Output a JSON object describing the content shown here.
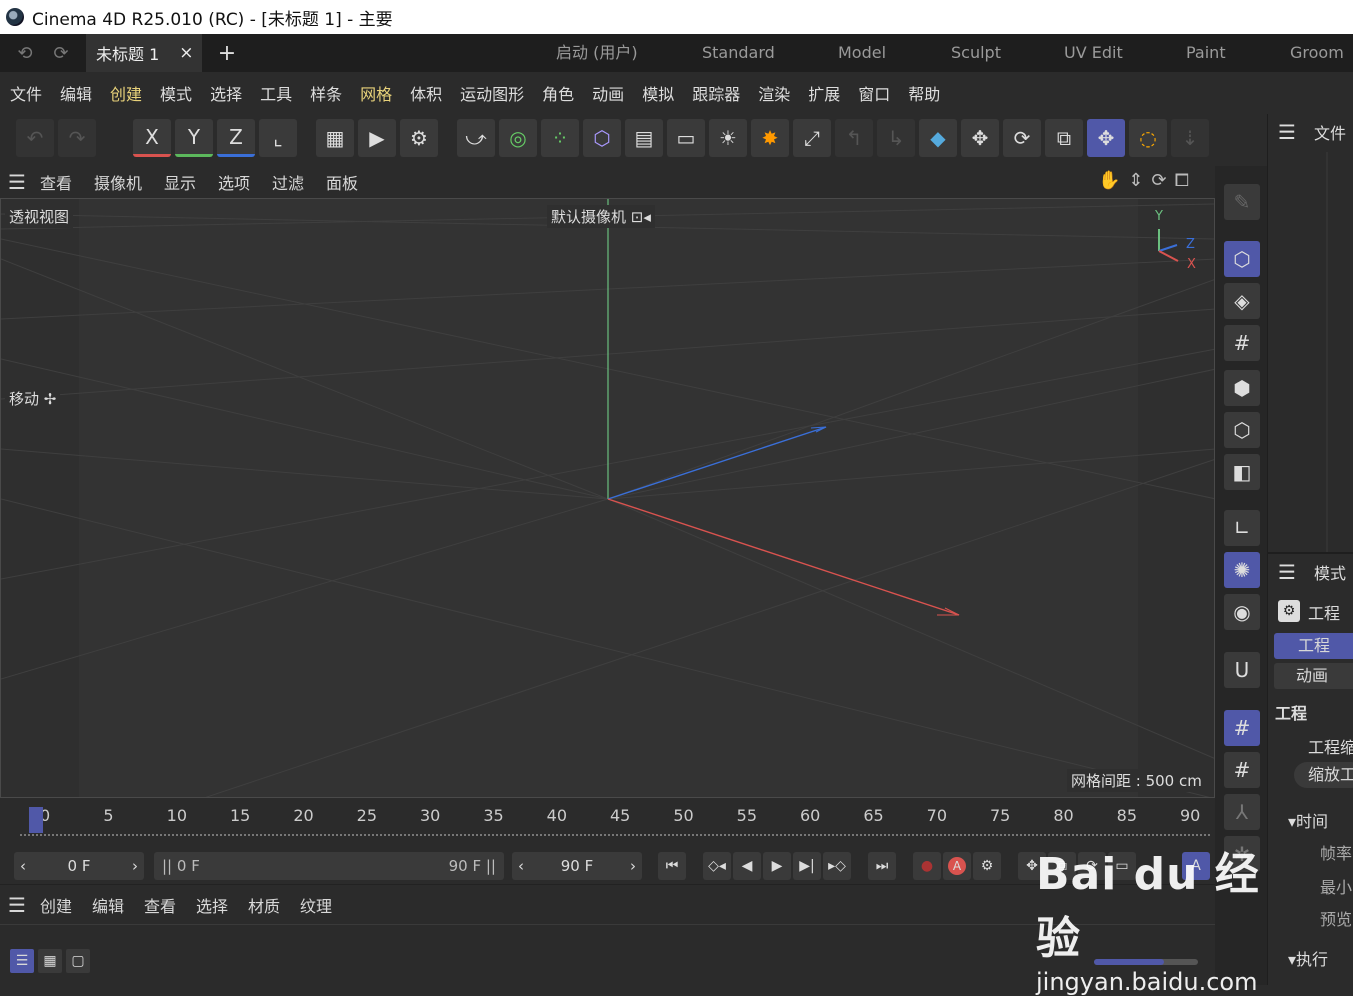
{
  "window": {
    "title": "Cinema 4D R25.010 (RC) - [未标题 1] - 主要"
  },
  "tabs": {
    "document": "未标题 1",
    "close": "×",
    "add": "+",
    "undo": "⟲",
    "redo": "⟳"
  },
  "layouts": [
    "启动 (用户)",
    "Standard",
    "Model",
    "Sculpt",
    "UV Edit",
    "Paint",
    "Groom"
  ],
  "menu": [
    "文件",
    "编辑",
    "创建",
    "模式",
    "选择",
    "工具",
    "样条",
    "网格",
    "体积",
    "运动图形",
    "角色",
    "动画",
    "模拟",
    "跟踪器",
    "渲染",
    "扩展",
    "窗口",
    "帮助"
  ],
  "toolbar": {
    "x": "X",
    "y": "Y",
    "z": "Z"
  },
  "viewport_menu": [
    "查看",
    "摄像机",
    "显示",
    "选项",
    "过滤",
    "面板"
  ],
  "viewport": {
    "view_name": "透视视图",
    "camera": "默认摄像机 ⊡◂",
    "move_label": "移动 ✢",
    "grid_spacing": "网格间距 : 500 cm",
    "axis_y": "Y",
    "axis_z": "Z",
    "axis_x": "X"
  },
  "timeline": {
    "ticks": [
      "0",
      "5",
      "10",
      "15",
      "20",
      "25",
      "30",
      "35",
      "40",
      "45",
      "50",
      "55",
      "60",
      "65",
      "70",
      "75",
      "80",
      "85",
      "90"
    ]
  },
  "transport": {
    "start": "0 F",
    "current": "0 F",
    "range_end": "90 F",
    "end": "90 F"
  },
  "material_menu": [
    "创建",
    "编辑",
    "查看",
    "选择",
    "材质",
    "纹理"
  ],
  "right_panel": {
    "file": "文件",
    "mode": "模式",
    "project": "工程",
    "tab_project": "工程",
    "tab_anim": "动画",
    "section_project": "工程",
    "scale_label": "工程缩",
    "scale_btn": "缩放工",
    "time_section": "▾时间",
    "fps": "帧率",
    "min": "最小",
    "preview": "预览",
    "exec_section": "▾执行"
  },
  "watermark": {
    "brand": "Bai  du 经验",
    "url": "jingyan.baidu.com"
  },
  "colors": {
    "accent": "#5058a8",
    "x_axis": "#d9534f",
    "y_axis": "#5cb85c",
    "z_axis": "#3a6fd8",
    "highlight_menu": "#e8d27a"
  }
}
